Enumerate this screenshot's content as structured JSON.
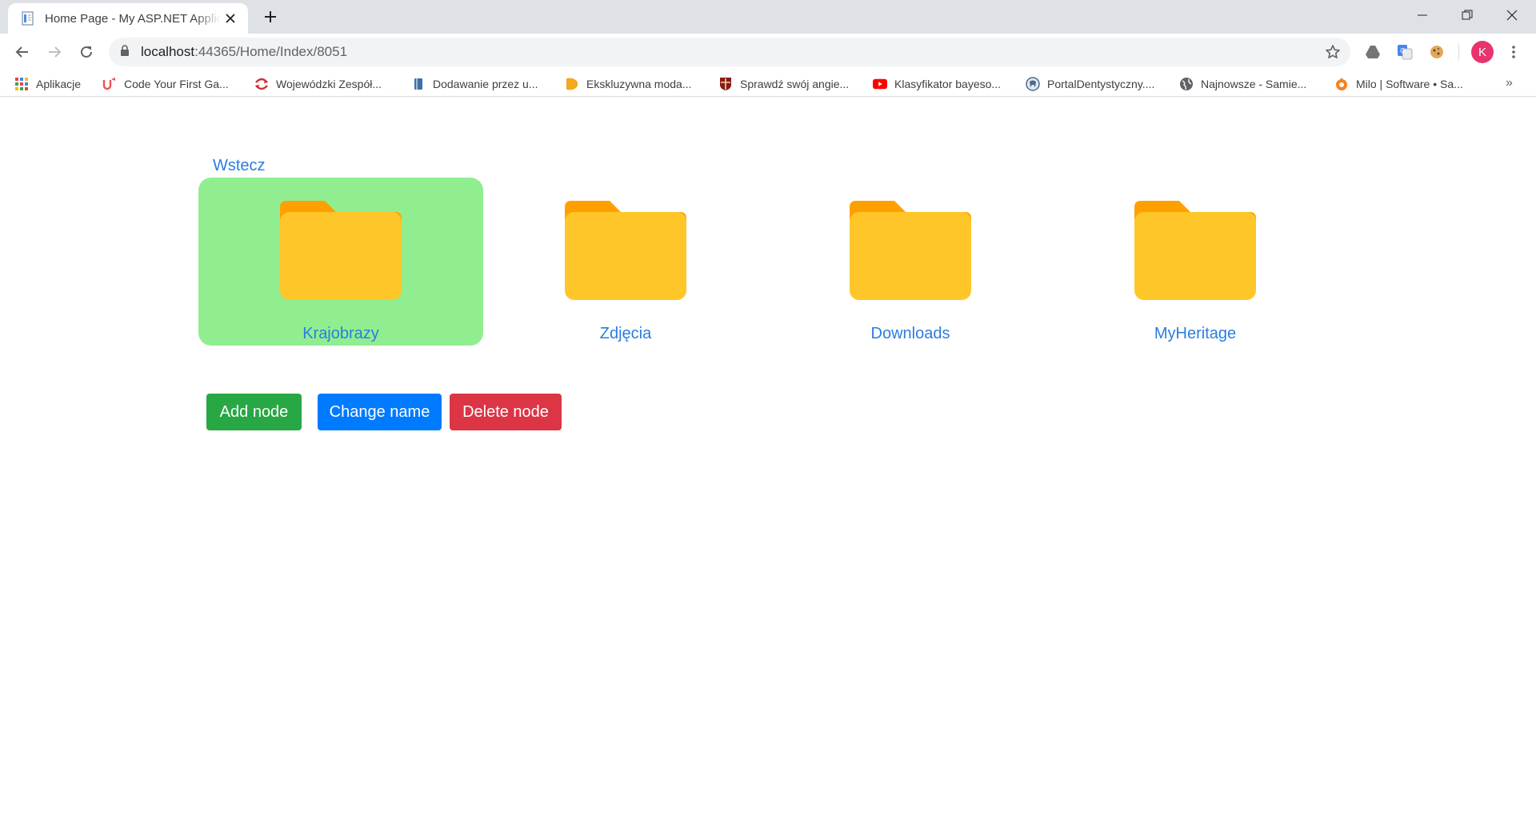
{
  "browser": {
    "tab_title": "Home Page - My ASP.NET Application",
    "url_host": "localhost",
    "url_path": ":44365/Home/Index/8051",
    "avatar_letter": "K",
    "bookmarks": [
      {
        "label": "Aplikacje",
        "icon": "apps-grid-icon"
      },
      {
        "label": "Code Your First Ga...",
        "icon": "udemy-icon"
      },
      {
        "label": "Wojewódzki Zespół...",
        "icon": "red-arrows-icon"
      },
      {
        "label": "Dodawanie przez u...",
        "icon": "book-icon"
      },
      {
        "label": "Ekskluzywna moda...",
        "icon": "orange-leaf-icon"
      },
      {
        "label": "Sprawdź swój angie...",
        "icon": "crest-icon"
      },
      {
        "label": "Klasyfikator bayeso...",
        "icon": "youtube-icon"
      },
      {
        "label": "PortalDentystyczny....",
        "icon": "tooth-icon"
      },
      {
        "label": "Najnowsze - Samie...",
        "icon": "globe-icon"
      },
      {
        "label": "Milo | Software • Sa...",
        "icon": "milo-icon"
      }
    ],
    "bookmarks_more": "»"
  },
  "page": {
    "back_link": "Wstecz",
    "folders": [
      {
        "name": "Krajobrazy",
        "selected": true
      },
      {
        "name": "Zdjęcia",
        "selected": false
      },
      {
        "name": "Downloads",
        "selected": false
      },
      {
        "name": "MyHeritage",
        "selected": false
      }
    ],
    "buttons": {
      "add": "Add node",
      "rename": "Change name",
      "delete": "Delete node"
    }
  },
  "colors": {
    "selected_bg": "#90ee90",
    "folder_front": "#ffc629",
    "folder_back": "#ffa000",
    "link": "#2a7de1",
    "add": "#28a745",
    "rename": "#007bff",
    "delete": "#dc3545"
  }
}
